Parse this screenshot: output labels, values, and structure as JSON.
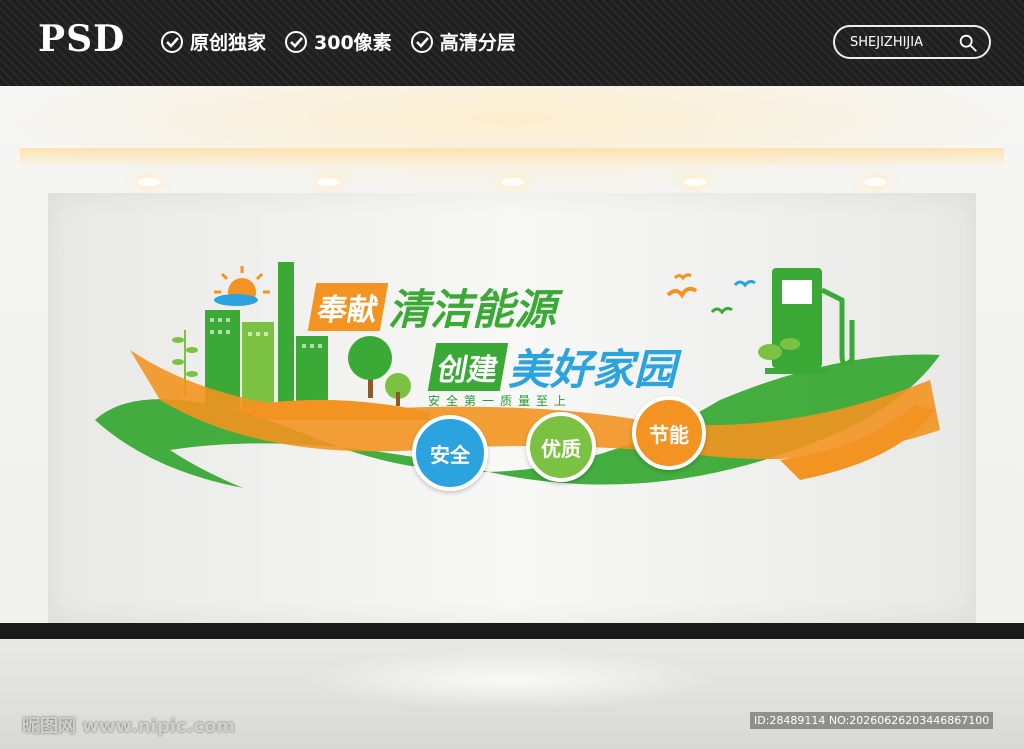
{
  "header": {
    "brand": "PSD",
    "badges": [
      "原创独家",
      "300像素",
      "高清分层"
    ],
    "search_text": "SHEJIZHIJIA"
  },
  "artwork": {
    "line1_a": "奉献",
    "line1_b": "清洁能源",
    "line2_a": "创建",
    "line2_b": "美好家园",
    "slogan": "安全第一质量至上",
    "circles": [
      "安全",
      "优质",
      "节能"
    ]
  },
  "watermark": {
    "site": "昵图网 www.nipic.com",
    "id": "ID:28489114 NO:20260626203446867100"
  },
  "colors": {
    "green": "#3aa935",
    "orange": "#f39321",
    "blue": "#2aa3df",
    "lightgreen": "#7cc242"
  }
}
